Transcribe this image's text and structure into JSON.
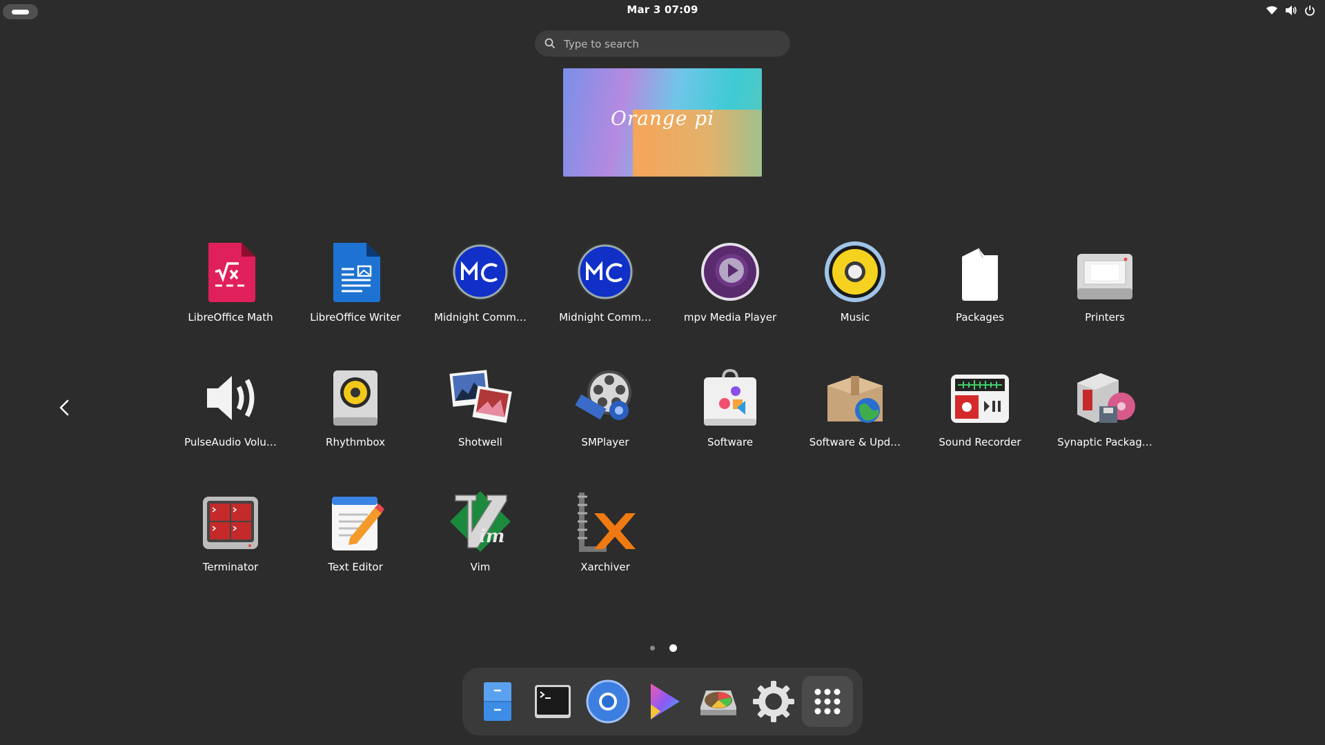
{
  "topbar": {
    "clock": "Mar 3  07:09",
    "tray_icons": [
      "wifi-icon",
      "volume-icon",
      "power-icon"
    ]
  },
  "search": {
    "placeholder": "Type to search"
  },
  "workspace": {
    "wallpaper_text": "Orange pi"
  },
  "apps": [
    {
      "label": "LibreOffice Math",
      "icon": "libreoffice-math-icon"
    },
    {
      "label": "LibreOffice Writer",
      "icon": "libreoffice-writer-icon"
    },
    {
      "label": "Midnight Comm…",
      "icon": "midnight-commander-icon"
    },
    {
      "label": "Midnight Comm…",
      "icon": "midnight-commander-icon"
    },
    {
      "label": "mpv Media Player",
      "icon": "mpv-icon"
    },
    {
      "label": "Music",
      "icon": "music-icon"
    },
    {
      "label": "Packages",
      "icon": "packages-icon"
    },
    {
      "label": "Printers",
      "icon": "printers-icon"
    },
    {
      "label": "PulseAudio Volu…",
      "icon": "pulseaudio-icon"
    },
    {
      "label": "Rhythmbox",
      "icon": "rhythmbox-icon"
    },
    {
      "label": "Shotwell",
      "icon": "shotwell-icon"
    },
    {
      "label": "SMPlayer",
      "icon": "smplayer-icon"
    },
    {
      "label": "Software",
      "icon": "software-icon"
    },
    {
      "label": "Software & Upd…",
      "icon": "software-updates-icon"
    },
    {
      "label": "Sound Recorder",
      "icon": "sound-recorder-icon"
    },
    {
      "label": "Synaptic Packag…",
      "icon": "synaptic-icon"
    },
    {
      "label": "Terminator",
      "icon": "terminator-icon"
    },
    {
      "label": "Text Editor",
      "icon": "text-editor-icon"
    },
    {
      "label": "Vim",
      "icon": "vim-icon"
    },
    {
      "label": "Xarchiver",
      "icon": "xarchiver-icon"
    }
  ],
  "pagination": {
    "current_page": 2,
    "total_pages": 2
  },
  "dock": [
    {
      "icon": "files-icon"
    },
    {
      "icon": "terminal-icon"
    },
    {
      "icon": "chromium-icon"
    },
    {
      "icon": "media-player-icon"
    },
    {
      "icon": "disk-usage-icon"
    },
    {
      "icon": "settings-gear-icon"
    },
    {
      "icon": "show-apps-grid-icon"
    }
  ],
  "colors": {
    "background": "#2c2c2c",
    "search_bg": "#3d3d3d",
    "dock_bg": "#3a3a3a"
  }
}
